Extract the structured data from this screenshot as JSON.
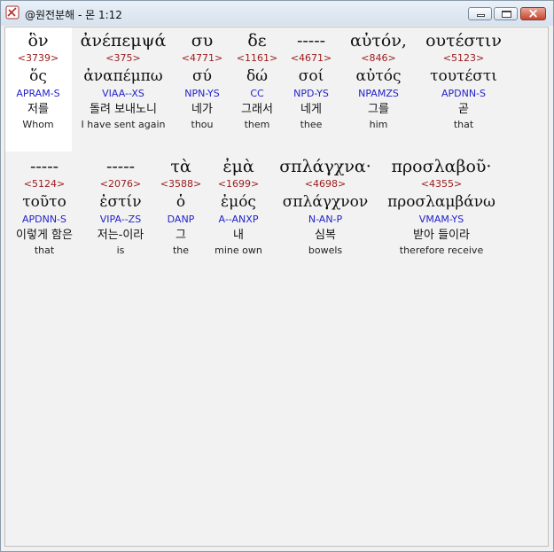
{
  "window": {
    "title": "@원전분해 - 몬 1:12"
  },
  "row1": [
    {
      "greek": "ὃν",
      "strong": "<3739>",
      "lemma": "ὅς",
      "parse": "APRAM-S",
      "korean": "저를",
      "english": "Whom"
    },
    {
      "greek": "ἀνέπεμψά",
      "strong": "<375>",
      "lemma": "ἀναπέμπω",
      "parse": "VIAA--XS",
      "korean": "돌려 보내노니",
      "english": "I have sent again"
    },
    {
      "greek": "συ",
      "strong": "<4771>",
      "lemma": "σύ",
      "parse": "NPN-YS",
      "korean": "네가",
      "english": "thou"
    },
    {
      "greek": "δε",
      "strong": "<1161>",
      "lemma": "δώ",
      "parse": "CC",
      "korean": "그래서",
      "english": "them"
    },
    {
      "greek": "-----",
      "strong": "<4671>",
      "lemma": "σοί",
      "parse": "NPD-YS",
      "korean": "네게",
      "english": "thee"
    },
    {
      "greek": "αὐτόν,",
      "strong": "<846>",
      "lemma": "αὐτός",
      "parse": "NPAMZS",
      "korean": "그를",
      "english": "him"
    },
    {
      "greek": "ουτέστιν",
      "strong": "<5123>",
      "lemma": "τουτέστι",
      "parse": "APDNN-S",
      "korean": "곧",
      "english": "that"
    }
  ],
  "row2": [
    {
      "greek": "-----",
      "strong": "<5124>",
      "lemma": "τοῦτο",
      "parse": "APDNN-S",
      "korean": "이렇게 함은",
      "english": "that"
    },
    {
      "greek": "-----",
      "strong": "<2076>",
      "lemma": "ἐστίν",
      "parse": "VIPA--ZS",
      "korean": "저는-이라",
      "english": "is"
    },
    {
      "greek": "τὰ",
      "strong": "<3588>",
      "lemma": "ὁ",
      "parse": "DANP",
      "korean": "그",
      "english": "the"
    },
    {
      "greek": "ἐμὰ",
      "strong": "<1699>",
      "lemma": "ἐμός",
      "parse": "A--ANXP",
      "korean": "내",
      "english": "mine own"
    },
    {
      "greek": "σπλάγχνα·",
      "strong": "<4698>",
      "lemma": "σπλάγχνον",
      "parse": "N-AN-P",
      "korean": "심복",
      "english": "bowels"
    },
    {
      "greek": "προσλαβοῦ·",
      "strong": "<4355>",
      "lemma": "προσλαμβάνω",
      "parse": "VMAM-YS",
      "korean": "받아 들이라",
      "english": "therefore receive"
    }
  ]
}
